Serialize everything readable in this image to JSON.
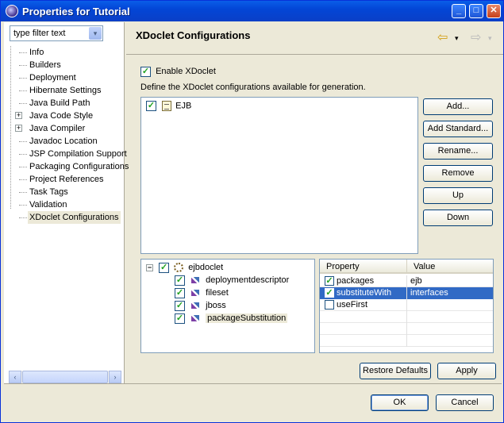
{
  "window": {
    "title": "Properties for Tutorial",
    "controls": {
      "minimize": "_",
      "maximize": "□",
      "close": "✕"
    }
  },
  "sidebar": {
    "filter": {
      "value": "type filter text",
      "dropdown_icon": "▾"
    },
    "items": [
      {
        "label": "Info",
        "expandable": false
      },
      {
        "label": "Builders",
        "expandable": false
      },
      {
        "label": "Deployment",
        "expandable": false
      },
      {
        "label": "Hibernate Settings",
        "expandable": false
      },
      {
        "label": "Java Build Path",
        "expandable": false
      },
      {
        "label": "Java Code Style",
        "expandable": true
      },
      {
        "label": "Java Compiler",
        "expandable": true
      },
      {
        "label": "Javadoc Location",
        "expandable": false
      },
      {
        "label": "JSP Compilation Support",
        "expandable": false
      },
      {
        "label": "Packaging Configurations",
        "expandable": false
      },
      {
        "label": "Project References",
        "expandable": false
      },
      {
        "label": "Task Tags",
        "expandable": false
      },
      {
        "label": "Validation",
        "expandable": false
      },
      {
        "label": "XDoclet Configurations",
        "expandable": false,
        "selected": true
      }
    ],
    "scroll": {
      "left": "‹",
      "right": "›"
    }
  },
  "page": {
    "title": "XDoclet Configurations",
    "back_icon": "⇦",
    "back_dropdown": "▾",
    "forward_icon": "⇨",
    "forward_dropdown": "▾",
    "enable_label": "Enable XDoclet",
    "enable_checked": "✓",
    "define_text": "Define the XDoclet configurations available for generation.",
    "configs": [
      {
        "label": "EJB",
        "checked": "✓"
      }
    ],
    "buttons": {
      "add": "Add...",
      "add_standard": "Add Standard...",
      "rename": "Rename...",
      "remove": "Remove",
      "up": "Up",
      "down": "Down"
    },
    "doclet_tree": {
      "collapse": "−",
      "root": {
        "label": "ejbdoclet",
        "checked": "✓"
      },
      "children": [
        {
          "label": "deploymentdescriptor",
          "checked": "✓"
        },
        {
          "label": "fileset",
          "checked": "✓"
        },
        {
          "label": "jboss",
          "checked": "✓"
        },
        {
          "label": "packageSubstitution",
          "checked": "✓"
        }
      ]
    },
    "properties": {
      "headers": {
        "property": "Property",
        "value": "Value"
      },
      "rows": [
        {
          "property": "packages",
          "value": "ejb",
          "checked": "✓"
        },
        {
          "property": "substituteWith",
          "value": "interfaces",
          "checked": "✓"
        },
        {
          "property": "useFirst",
          "value": "",
          "checked": ""
        }
      ]
    },
    "restore_defaults": "Restore Defaults",
    "apply": "Apply"
  },
  "footer": {
    "ok": "OK",
    "cancel": "Cancel"
  }
}
